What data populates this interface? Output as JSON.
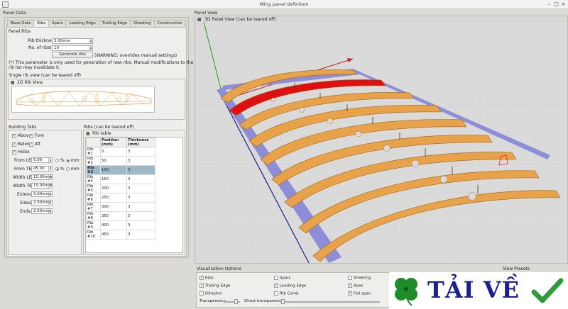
{
  "window": {
    "title": "Wing panel definition"
  },
  "left_panel": {
    "title": "Panel Data",
    "tabs": [
      "Base Data",
      "Ribs",
      "Spars",
      "Leading Edge",
      "Trailing Edge",
      "Sheeting",
      "Construction"
    ],
    "active_tab": "Ribs",
    "panel_ribs": {
      "title": "Panel Ribs",
      "rib_thickness_label": "Rib thickness:",
      "rib_thickness_value": "3.00mm",
      "num_ribs_label": "No. of ribs(*):",
      "num_ribs_value": "10",
      "generate_button": "Generate ribs",
      "warning": "(WARNING: overrides manual settings)",
      "note_line1": "(*) This parameter is only used for generation of new ribs. Manual modifications to the",
      "note_line2": "rib list may invalidate it."
    },
    "single_rib_view": {
      "title": "Single rib view (can be teared off)",
      "subtitle": "2D Rib View"
    },
    "building_tabs": {
      "title": "Building Tabs",
      "above_label": "Above",
      "above_checked": true,
      "fore_label": "Fore",
      "fore_checked": true,
      "below_label": "Below",
      "below_checked": true,
      "aft_label": "Aft",
      "aft_checked": true,
      "holes_label": "Holes",
      "holes_checked": true,
      "from_le_label": "From LE:",
      "from_le_value": "5.00",
      "from_te_label": "From TE:",
      "from_te_value": "45.00",
      "pct_label": "%",
      "mm_label": "mm",
      "width_le_label": "Width LE:",
      "width_le_value": "15.00mm",
      "width_te_label": "Width TE:",
      "width_te_value": "15.00mm",
      "extend_label": "Extend:",
      "extend_value": "5.00mm",
      "sides_label": "Sides:",
      "sides_value": "2.50mm",
      "ends_label": "Ends:",
      "ends_value": "2.50mm"
    },
    "ribs_table": {
      "title": "Ribs (can be teared off)",
      "subtitle": "Rib table",
      "headers": [
        "Position (mm)",
        "Thickness (mm)"
      ],
      "rows": [
        {
          "name": "Rib #1",
          "position": "0",
          "thickness": "3"
        },
        {
          "name": "Rib #2",
          "position": "50",
          "thickness": "3"
        },
        {
          "name": "Rib #3",
          "position": "100",
          "thickness": "3"
        },
        {
          "name": "Rib #4",
          "position": "150",
          "thickness": "3"
        },
        {
          "name": "Rib #5",
          "position": "200",
          "thickness": "3"
        },
        {
          "name": "Rib #6",
          "position": "250",
          "thickness": "3"
        },
        {
          "name": "Rib #7",
          "position": "300",
          "thickness": "3"
        },
        {
          "name": "Rib #8",
          "position": "350",
          "thickness": "3"
        },
        {
          "name": "Rib #9",
          "position": "400",
          "thickness": "3"
        },
        {
          "name": "Rib #10",
          "position": "450",
          "thickness": "3"
        }
      ],
      "selected_row": 2
    }
  },
  "right_panel": {
    "title": "Panel View",
    "view_subtitle": "3D Panel View (can be teared off)",
    "vis_options": {
      "title": "Visualisation Options",
      "ribs": "Ribs",
      "ribs_checked": true,
      "spars": "Spars",
      "spars_checked": false,
      "sheeting": "Sheeting",
      "sheeting_checked": false,
      "trailing_edge": "Trailing Edge",
      "trailing_edge_checked": true,
      "leading_edge": "Leading Edge",
      "leading_edge_checked": true,
      "axes": "Axes",
      "axes_checked": true,
      "dihedral": "Dihedral",
      "dihedral_checked": false,
      "rib_comb": "Rib Comb",
      "rib_comb_checked": false,
      "foil_span": "Foil span",
      "foil_span_checked": true,
      "transparency": "Transparency:",
      "ghost_transparency": "Ghost transparency:"
    },
    "view_presets": {
      "title": "View Presets"
    }
  },
  "watermark": {
    "text": "TẢI VỀ"
  },
  "colors": {
    "rib": "#e8a24a",
    "rib_edge": "#a06418",
    "selected_rib": "#e01010",
    "edge_bar": "#8a8ad8",
    "axis_x": "#c02020",
    "axis_y": "#20a020",
    "axis_z": "#1a1a8a",
    "viewport_bg": "#d8d8d8"
  }
}
